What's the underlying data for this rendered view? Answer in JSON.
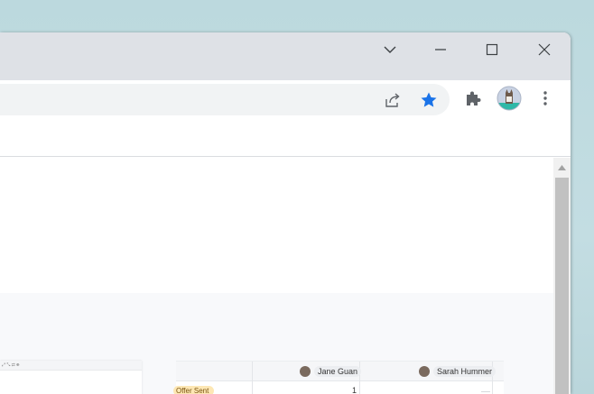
{
  "window_controls": {
    "tab_search_icon": "chevron-down-icon",
    "minimize_icon": "minimize-icon",
    "maximize_icon": "maximize-icon",
    "close_icon": "close-icon"
  },
  "toolbar": {
    "share_icon": "share-icon",
    "bookmark_icon": "star-icon",
    "bookmark_color": "#1a73e8",
    "extensions_icon": "puzzle-icon",
    "profile_icon": "avatar",
    "menu_icon": "kebab-menu-icon"
  },
  "page": {
    "thumbnail_toolbar_text": "⤢ ⤡ ⇄ ⊕"
  },
  "table": {
    "assignees": [
      "Jane Guan",
      "Sarah Hummer"
    ],
    "row": {
      "status": "Offer Sent",
      "status_color": "#fde7b4",
      "count": "1"
    }
  }
}
